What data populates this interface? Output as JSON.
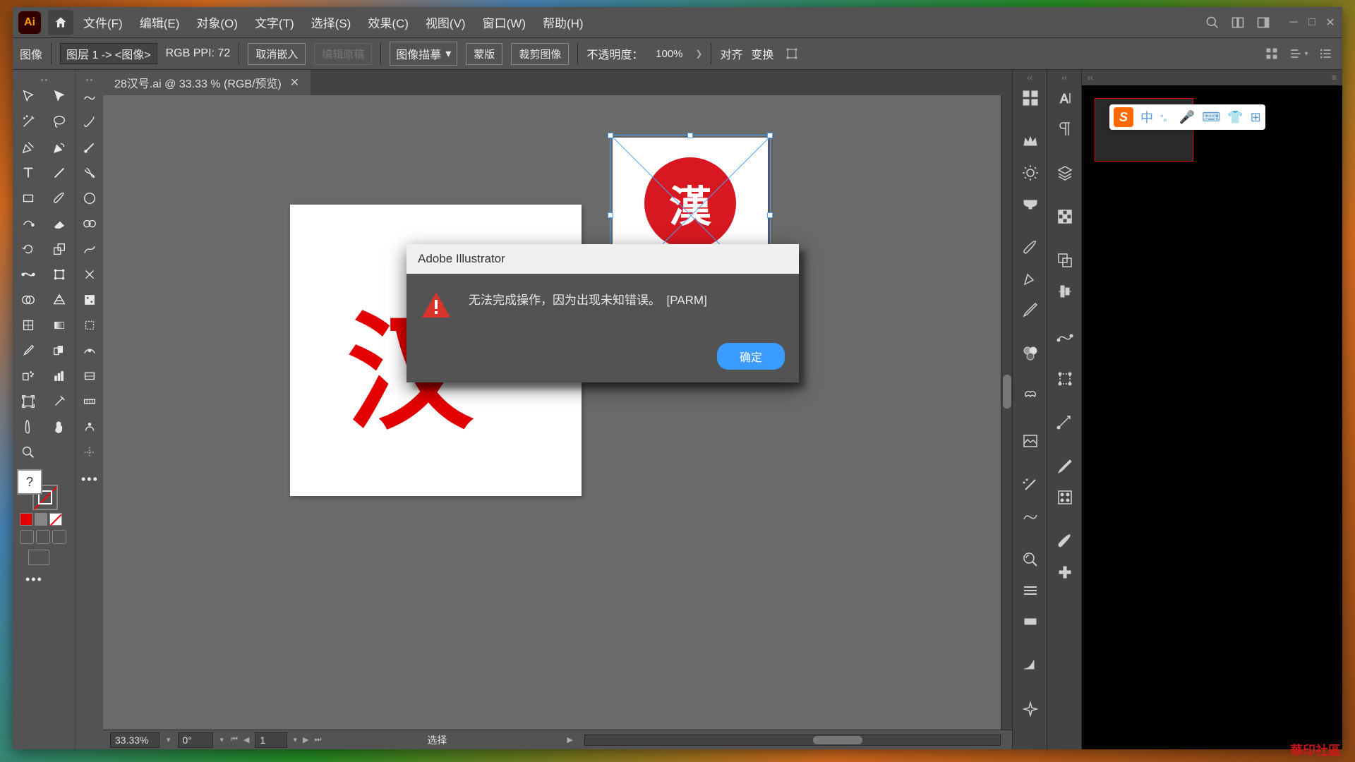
{
  "app_logo": "Ai",
  "menu": {
    "file": "文件(F)",
    "edit": "编辑(E)",
    "object": "对象(O)",
    "type": "文字(T)",
    "select": "选择(S)",
    "effect": "效果(C)",
    "view": "视图(V)",
    "window": "窗口(W)",
    "help": "帮助(H)"
  },
  "options": {
    "context": "图像",
    "layer_info": "图层 1 -> <图像>",
    "color_mode": "RGB PPI: 72",
    "unembed": "取消嵌入",
    "edit_original": "编辑原稿",
    "image_trace": "图像描摹",
    "mask": "蒙版",
    "crop": "裁剪图像",
    "opacity_label": "不透明度：",
    "opacity_value": "100%",
    "align": "对齐",
    "transform": "变换"
  },
  "tab": {
    "name": "28汉号.ai @ 33.33 % (RGB/预览)"
  },
  "artboard": {
    "glyph": "汉"
  },
  "seal": {
    "glyph": "漢"
  },
  "dialog": {
    "title": "Adobe Illustrator",
    "message": "无法完成操作，因为出现未知错误。　[PARM]",
    "ok": "确定"
  },
  "status": {
    "zoom": "33.33%",
    "angle": "0°",
    "page": "1",
    "mode": "选择"
  },
  "ime": {
    "logo": "S",
    "lang": "中",
    "punct": "°。"
  },
  "watermark": "華印社區"
}
